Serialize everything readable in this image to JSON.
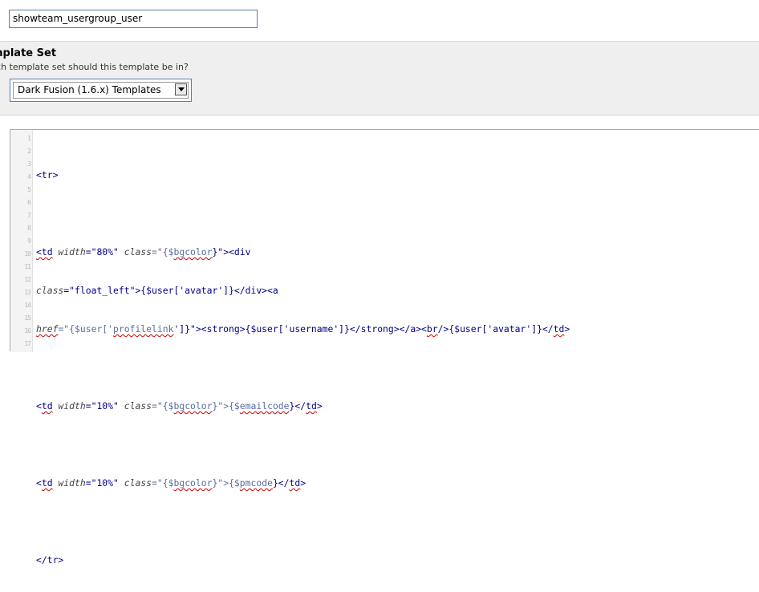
{
  "template_title": {
    "value": "showteam_usergroup_user"
  },
  "template_set": {
    "title": "mplate Set",
    "description": "ich template set should this template be in?",
    "selected": "Dark Fusion (1.6.x) Templates"
  },
  "editor": {
    "gutter_marks": [
      "1",
      "2",
      "3",
      "4",
      "5",
      "6",
      "7",
      "8",
      "9",
      "10",
      "11",
      "12",
      "13",
      "14",
      "15",
      "16",
      "17"
    ],
    "code": {
      "l1": "<tr>",
      "l3a": "<td",
      "l3b": "width",
      "l3c": "=\"80%\"",
      "l3d": "class",
      "l3e": "=\"{$",
      "l3f": "bgcolor",
      "l3g": "}\"><div",
      "l4a": "class",
      "l4b": "=\"float_left\">{$user['avatar']}</div><a",
      "l5a": "href",
      "l5b": "=\"{$user['",
      "l5c": "profilelink",
      "l5d": "']}\"><strong>{$user['username']}</strong></a><",
      "l5e": "br",
      "l5f": "/>{$user['avatar']}</",
      "l5g": "td",
      "l5h": ">",
      "l7a": "<",
      "l7b": "td",
      "l7c": "width",
      "l7d": "=\"10%\"",
      "l7e": "class",
      "l7f": "=\"{$",
      "l7g": "bgcolor",
      "l7h": "}\">{$",
      "l7i": "emailcode",
      "l7j": "}</",
      "l7k": "td",
      "l7l": ">",
      "l9a": "<",
      "l9b": "td",
      "l9c": "width",
      "l9d": "=\"10%\"",
      "l9e": "class",
      "l9f": "=\"{$",
      "l9g": "bgcolor",
      "l9h": "}\">{$",
      "l9i": "pmcode",
      "l9j": "}</",
      "l9k": "td",
      "l9l": ">",
      "l11": "</tr>"
    }
  }
}
